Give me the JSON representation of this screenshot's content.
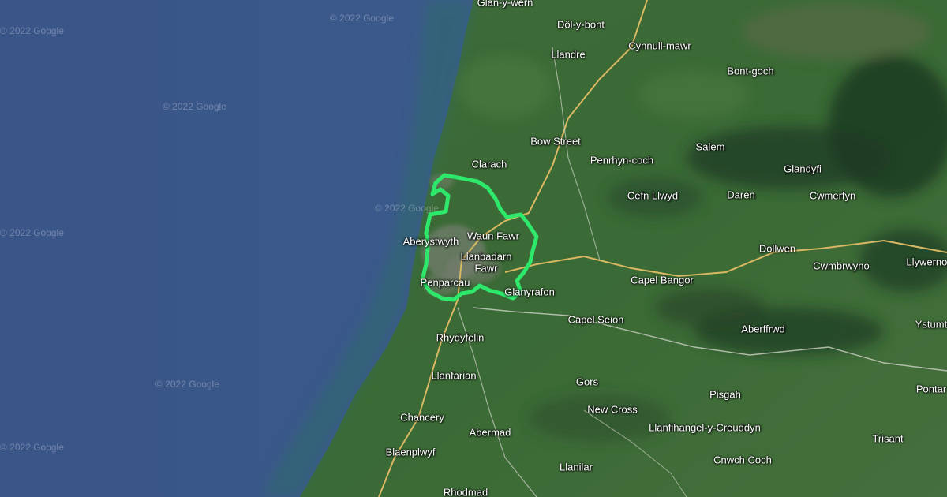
{
  "map": {
    "type": "satellite",
    "watermark": "© 2022 Google",
    "boundary_color": "#2ee86b",
    "places": [
      {
        "key": "glanywern",
        "label": "Glan-y-wern"
      },
      {
        "key": "dolybont",
        "label": "Dôl-y-bont"
      },
      {
        "key": "cynnullmawr",
        "label": "Cynnull-mawr"
      },
      {
        "key": "llandre",
        "label": "Llandre"
      },
      {
        "key": "bontgoch",
        "label": "Bont-goch"
      },
      {
        "key": "bowstreet",
        "label": "Bow Street"
      },
      {
        "key": "salem",
        "label": "Salem"
      },
      {
        "key": "clarach",
        "label": "Clarach"
      },
      {
        "key": "penrhyncoch",
        "label": "Penrhyn-coch"
      },
      {
        "key": "glandyfi",
        "label": "Glandyfi"
      },
      {
        "key": "cefnllwyd",
        "label": "Cefn Llwyd"
      },
      {
        "key": "daren",
        "label": "Daren"
      },
      {
        "key": "cwmerfyn",
        "label": "Cwmerfyn"
      },
      {
        "key": "aberystwyth",
        "label": "Aberystwyth"
      },
      {
        "key": "waunfawr",
        "label": "Waun Fawr"
      },
      {
        "key": "llanbadarn1",
        "label": "Llanbadarn"
      },
      {
        "key": "llanbadarn2",
        "label": "Fawr"
      },
      {
        "key": "dollwen",
        "label": "Dollwen"
      },
      {
        "key": "cwmbrwyno",
        "label": "Cwmbrwyno"
      },
      {
        "key": "llywernog",
        "label": "Llywernog"
      },
      {
        "key": "capelbangor",
        "label": "Capel Bangor"
      },
      {
        "key": "penparcau",
        "label": "Penparcau"
      },
      {
        "key": "glanyrafon",
        "label": "Glanyrafon"
      },
      {
        "key": "capelseion",
        "label": "Capel Seion"
      },
      {
        "key": "aberfrwd",
        "label": "Aberffrwd"
      },
      {
        "key": "ystumtuen",
        "label": "Ystumt"
      },
      {
        "key": "rhydyfelin",
        "label": "Rhydyfelin"
      },
      {
        "key": "llanfarian",
        "label": "Llanfarian"
      },
      {
        "key": "gors",
        "label": "Gors"
      },
      {
        "key": "pisgah",
        "label": "Pisgah"
      },
      {
        "key": "pontarfynach",
        "label": "Pontar"
      },
      {
        "key": "newcross",
        "label": "New Cross"
      },
      {
        "key": "chancery",
        "label": "Chancery"
      },
      {
        "key": "llanfihangel",
        "label": "Llanfihangel-y-Creuddyn"
      },
      {
        "key": "abermad",
        "label": "Abermad"
      },
      {
        "key": "trisant",
        "label": "Trisant"
      },
      {
        "key": "blaenplwyf",
        "label": "Blaenplwyf"
      },
      {
        "key": "cnwchcoch",
        "label": "Cnwch Coch"
      },
      {
        "key": "llanilar",
        "label": "Llanilar"
      },
      {
        "key": "rhodmad",
        "label": "Rhodmad"
      }
    ]
  }
}
